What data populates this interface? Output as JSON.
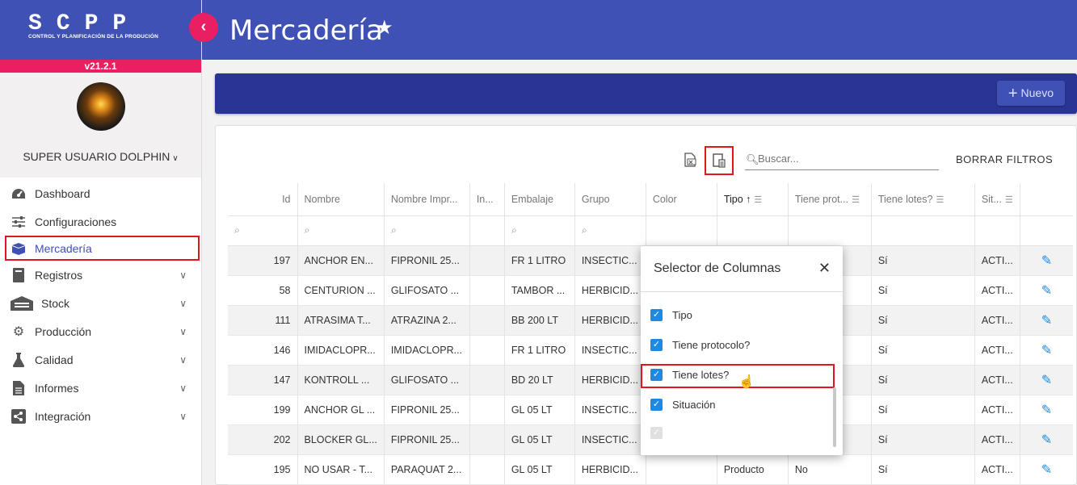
{
  "brand": {
    "logo": "SCPP",
    "subtitle": "CONTROL Y PLANIFICACIÓN DE LA PRODUCIÓN",
    "version": "v21.2.1"
  },
  "user": {
    "name": "SUPER USUARIO DOLPHIN"
  },
  "sidebar": {
    "items": [
      {
        "label": "Dashboard",
        "icon": "gauge-icon"
      },
      {
        "label": "Configuraciones",
        "icon": "sliders-icon"
      },
      {
        "label": "Mercadería",
        "icon": "boxes-icon",
        "active": true
      },
      {
        "label": "Registros",
        "icon": "book-icon"
      },
      {
        "label": "Stock",
        "icon": "warehouse-icon"
      },
      {
        "label": "Producción",
        "icon": "cog-icon"
      },
      {
        "label": "Calidad",
        "icon": "flask-icon"
      },
      {
        "label": "Informes",
        "icon": "document-icon"
      },
      {
        "label": "Integración",
        "icon": "share-icon"
      }
    ]
  },
  "header": {
    "title": "Mercadería"
  },
  "toolbar": {
    "new_label": "Nuevo"
  },
  "search": {
    "placeholder": "Buscar..."
  },
  "clear_filters_label": "BORRAR FILTROS",
  "table": {
    "columns": [
      "Id",
      "Nombre",
      "Nombre Impr...",
      "In...",
      "Embalaje",
      "Grupo",
      "Color",
      "Tipo",
      "Tiene prot...",
      "Tiene lotes?",
      "Sit..."
    ],
    "rows": [
      [
        "197",
        "ANCHOR EN...",
        "FIPRONIL 25...",
        "",
        "FR 1 LITRO",
        "INSECTIC...",
        "",
        "",
        "",
        "Sí",
        "ACTI..."
      ],
      [
        "58",
        "CENTURION ...",
        "GLIFOSATO ...",
        "",
        "TAMBOR ...",
        "HERBICID...",
        "",
        "",
        "",
        "Sí",
        "ACTI..."
      ],
      [
        "111",
        "ATRASIMA T...",
        "ATRAZINA 2...",
        "",
        "BB 200 LT",
        "HERBICID...",
        "",
        "",
        "",
        "Sí",
        "ACTI..."
      ],
      [
        "146",
        "IMIDACLOPR...",
        "IMIDACLOPR...",
        "",
        "FR 1 LITRO",
        "INSECTIC...",
        "",
        "",
        "",
        "Sí",
        "ACTI..."
      ],
      [
        "147",
        "KONTROLL ...",
        "GLIFOSATO ...",
        "",
        "BD 20 LT",
        "HERBICID...",
        "",
        "",
        "",
        "Sí",
        "ACTI..."
      ],
      [
        "199",
        "ANCHOR GL ...",
        "FIPRONIL 25...",
        "",
        "GL 05 LT",
        "INSECTIC...",
        "",
        "",
        "",
        "Sí",
        "ACTI..."
      ],
      [
        "202",
        "BLOCKER GL...",
        "FIPRONIL 25...",
        "",
        "GL 05 LT",
        "INSECTIC...",
        "",
        "",
        "",
        "Sí",
        "ACTI..."
      ],
      [
        "195",
        "NO USAR - T...",
        "PARAQUAT 2...",
        "",
        "GL 05 LT",
        "HERBICID...",
        "",
        "Producto",
        "No",
        "Sí",
        "ACTI..."
      ]
    ]
  },
  "column_selector": {
    "title": "Selector de Columnas",
    "options": [
      {
        "label": "Tipo",
        "checked": true
      },
      {
        "label": "Tiene protocolo?",
        "checked": true
      },
      {
        "label": "Tiene lotes?",
        "checked": true
      },
      {
        "label": "Situación",
        "checked": true
      },
      {
        "label": "",
        "checked": true,
        "disabled": true
      }
    ]
  },
  "colors": {
    "primary": "#3f51b5",
    "dark_primary": "#283593",
    "accent": "#e91e63",
    "highlight": "#e0161e",
    "check": "#1e88e5"
  }
}
